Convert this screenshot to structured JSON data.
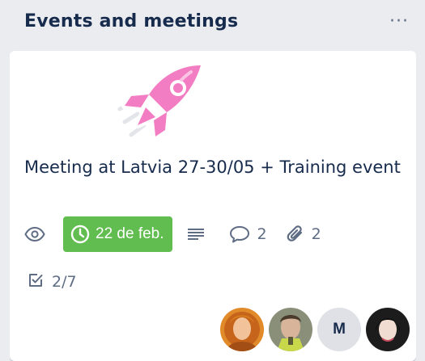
{
  "list": {
    "title": "Events and meetings",
    "menu_label": "···"
  },
  "card": {
    "title": "Meeting at Latvia 27-30/05 + Training event",
    "sticker": "rocket-sticker",
    "badges": {
      "watch_icon": "eye-icon",
      "due_date": "22 de feb.",
      "due_color": "#61bd4f",
      "description_icon": "description-icon",
      "comments_count": "2",
      "attachments_count": "2",
      "checklist": "2/7"
    },
    "members": [
      {
        "type": "photo",
        "name": "member-avatar-1"
      },
      {
        "type": "photo",
        "name": "member-avatar-2"
      },
      {
        "type": "initials",
        "initials": "M",
        "name": "member-avatar-m"
      },
      {
        "type": "photo",
        "name": "member-avatar-4"
      }
    ]
  },
  "colors": {
    "list_bg": "#ebecf0",
    "card_bg": "#ffffff",
    "text": "#172b4d",
    "muted": "#5e6c84",
    "rocket": "#f37dc3"
  }
}
